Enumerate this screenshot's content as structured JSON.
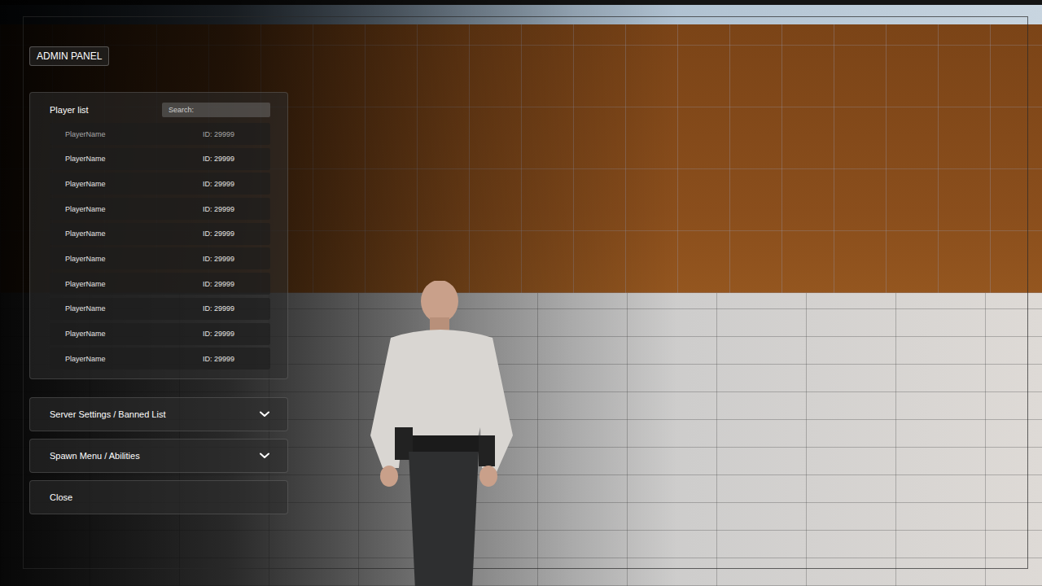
{
  "panel_badge": "ADMIN PANEL",
  "player_list": {
    "title": "Player list",
    "search": {
      "placeholder": "Search:"
    },
    "players": [
      {
        "name": "PlayerName",
        "id": "ID: 29999",
        "dimmed": true
      },
      {
        "name": "PlayerName",
        "id": "ID: 29999",
        "dimmed": false
      },
      {
        "name": "PlayerName",
        "id": "ID: 29999",
        "dimmed": false
      },
      {
        "name": "PlayerName",
        "id": "ID: 29999",
        "dimmed": false
      },
      {
        "name": "PlayerName",
        "id": "ID: 29999",
        "dimmed": false
      },
      {
        "name": "PlayerName",
        "id": "ID: 29999",
        "dimmed": false
      },
      {
        "name": "PlayerName",
        "id": "ID: 29999",
        "dimmed": false
      },
      {
        "name": "PlayerName",
        "id": "ID: 29999",
        "dimmed": false
      },
      {
        "name": "PlayerName",
        "id": "ID: 29999",
        "dimmed": false
      },
      {
        "name": "PlayerName",
        "id": "ID: 29999",
        "dimmed": false
      }
    ]
  },
  "sections": [
    {
      "label": "Server Settings / Banned List",
      "kind": "accordion",
      "expanded": false
    },
    {
      "label": "Spawn Menu / Abilities",
      "kind": "accordion",
      "expanded": false
    },
    {
      "label": "Close",
      "kind": "button"
    }
  ]
}
